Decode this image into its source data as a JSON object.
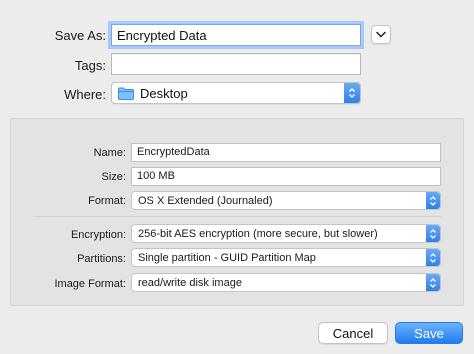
{
  "save_as": {
    "label": "Save As:",
    "value": "Encrypted Data"
  },
  "tags": {
    "label": "Tags:",
    "value": ""
  },
  "where": {
    "label": "Where:",
    "value": "Desktop"
  },
  "options": {
    "name": {
      "label": "Name:",
      "value": "EncryptedData"
    },
    "size": {
      "label": "Size:",
      "value": "100 MB"
    },
    "format": {
      "label": "Format:",
      "value": "OS X Extended (Journaled)"
    },
    "encryption": {
      "label": "Encryption:",
      "value": "256-bit AES encryption (more secure, but slower)"
    },
    "partitions": {
      "label": "Partitions:",
      "value": "Single partition - GUID Partition Map"
    },
    "image_format": {
      "label": "Image Format:",
      "value": "read/write disk image"
    }
  },
  "buttons": {
    "cancel": "Cancel",
    "save": "Save"
  },
  "colors": {
    "accent": "#2f7fea",
    "focus_ring": "#a8c8f5"
  }
}
